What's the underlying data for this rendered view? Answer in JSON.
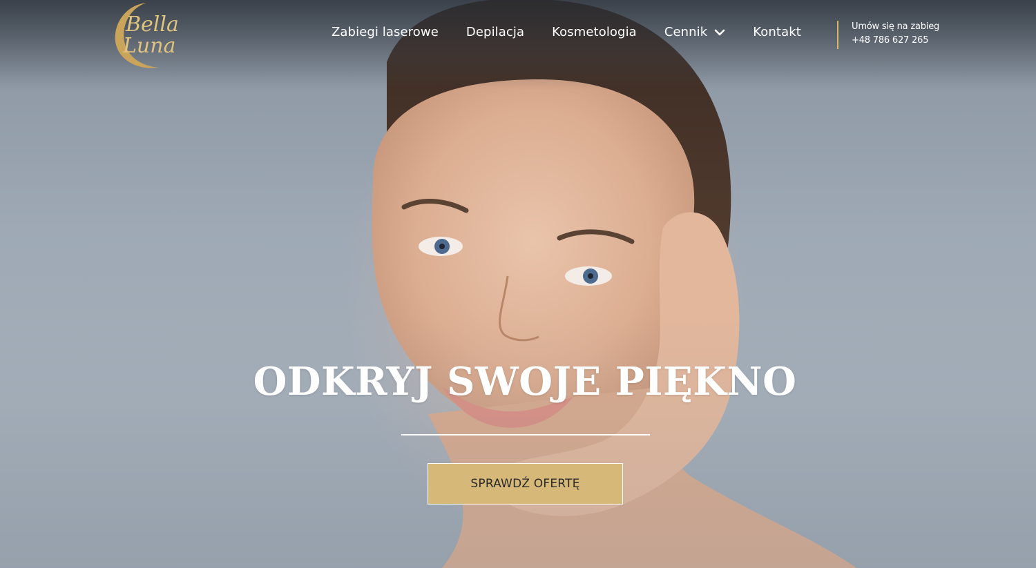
{
  "header": {
    "logo_text_line1": "Bella",
    "logo_text_line2": "Luna",
    "nav": [
      {
        "label": "Zabiegi laserowe"
      },
      {
        "label": "Depilacja"
      },
      {
        "label": "Kosmetologia"
      },
      {
        "label": "Cennik",
        "has_dropdown": true,
        "icon": "chevron-down-icon"
      },
      {
        "label": "Kontakt"
      }
    ],
    "contact": {
      "cta_label": "Umów się na zabieg",
      "phone": "+48 786 627 265"
    }
  },
  "hero": {
    "headline": "ODKRYJ SWOJE PIĘKNO",
    "button_label": "SPRAWDŹ OFERTĘ"
  },
  "colors": {
    "accent_gold": "#d6b978",
    "divider_gold": "#d8b765",
    "text_white": "#ffffff"
  }
}
